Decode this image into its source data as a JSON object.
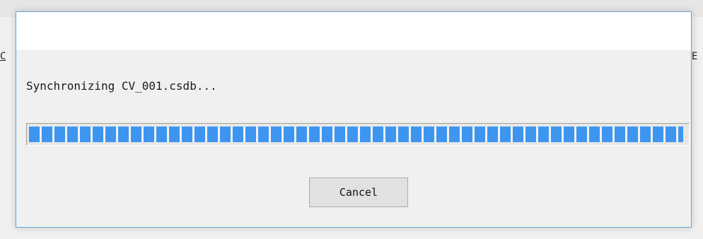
{
  "dialog": {
    "message": "Synchronizing CV_001.csdb...",
    "progress_fraction": 0.995,
    "cancel_label": "Cancel",
    "accent_color": "#3d95f0",
    "border_color": "#63a3d6"
  },
  "background": {
    "left_fragment": "C",
    "right_fragment": "E"
  }
}
